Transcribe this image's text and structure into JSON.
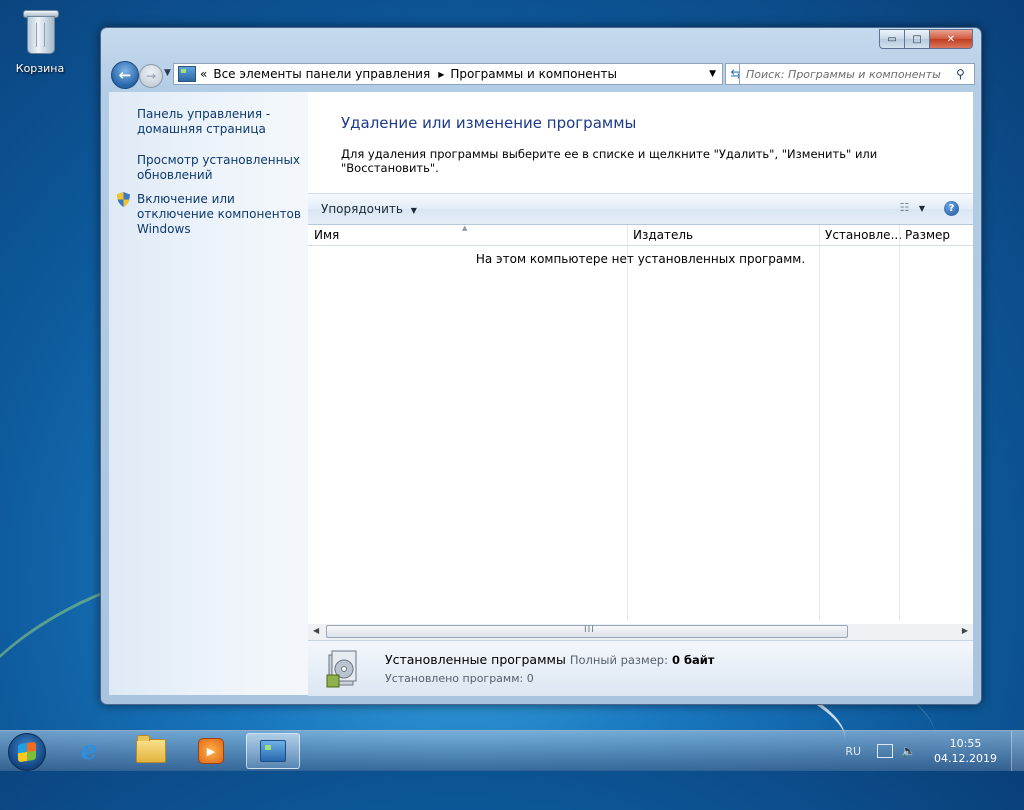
{
  "desktop": {
    "recycle_bin_label": "Корзина"
  },
  "window": {
    "caption_buttons": {
      "minimize": "▭",
      "maximize": "□",
      "close": "✕"
    }
  },
  "navbar": {
    "breadcrumb_prefix": "«",
    "breadcrumbs": [
      "Все элементы панели управления",
      "Программы и компоненты"
    ],
    "search_placeholder": "Поиск: Программы и компоненты"
  },
  "left_pane": {
    "tasks": [
      "Панель управления - домашняя страница",
      "Просмотр установленных обновлений",
      "Включение или отключение компонентов Windows"
    ]
  },
  "content": {
    "heading": "Удаление или изменение программы",
    "description": "Для удаления программы выберите ее в списке и щелкните \"Удалить\", \"Изменить\" или \"Восстановить\".",
    "organize_label": "Упорядочить",
    "columns": [
      "Имя",
      "Издатель",
      "Установле...",
      "Размер"
    ],
    "empty_message": "На этом компьютере нет установленных программ.",
    "scroll_grip": "III"
  },
  "details": {
    "title": "Установленные программы",
    "size_label": "Полный размер:",
    "size_value": "0 байт",
    "count_text": "Установлено программ: 0"
  },
  "taskbar": {
    "pinned": [
      "internet-explorer",
      "windows-explorer",
      "media-player",
      "control-panel"
    ],
    "active": "control-panel",
    "language": "RU",
    "time": "10:55",
    "date": "04.12.2019"
  }
}
